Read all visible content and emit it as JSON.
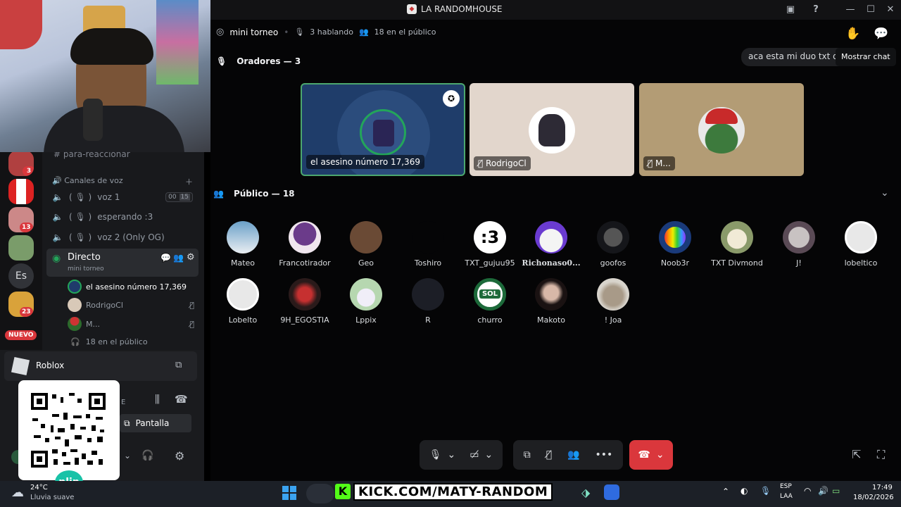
{
  "window": {
    "title": "LA RANDOMHOUSE"
  },
  "stage": {
    "name": "mini torneo",
    "speaking": "3 hablando",
    "audience": "18 en el público",
    "chat_preview": "aca esta mi duo txt di",
    "show_chat_tooltip": "Mostrar chat",
    "speakers_header": "Oradores — 3",
    "public_header": "Público — 18",
    "speakers": [
      {
        "label": "el asesino número 17,369"
      },
      {
        "label": "RodrigoCl"
      },
      {
        "label": "M..."
      }
    ],
    "public": [
      {
        "name": "Mateo"
      },
      {
        "name": "Francotirador"
      },
      {
        "name": "Geo"
      },
      {
        "name": "Toshiro"
      },
      {
        "name": "TXT_gujuu95"
      },
      {
        "name": "Richonaso0..."
      },
      {
        "name": "goofos"
      },
      {
        "name": "Noob3r"
      },
      {
        "name": "TXT Divmond"
      },
      {
        "name": "J!"
      },
      {
        "name": "lobeltico"
      },
      {
        "name": "Lobelto"
      },
      {
        "name": "9H_EGOSTIA"
      },
      {
        "name": "Lppix"
      },
      {
        "name": "R"
      },
      {
        "name": "churro"
      },
      {
        "name": "Makoto"
      },
      {
        "name": "! Joa"
      }
    ],
    "tile_avatar_text": {
      "third_1": ":3",
      "churro": "SOL"
    }
  },
  "sidebar": {
    "channel_partial": "para-reaccionar",
    "voice_header": "Canales de voz",
    "voice_channels": [
      {
        "name": "voz 1",
        "count_a": "00",
        "count_b": "15"
      },
      {
        "name": "esperando :3"
      },
      {
        "name": "voz 2 (Only OG)"
      }
    ],
    "live": {
      "name": "Directo",
      "subtitle": "mini torneo"
    },
    "members": [
      {
        "name": "el asesino número 17,369"
      },
      {
        "name": "RodrigoCl"
      },
      {
        "name": "M..."
      }
    ],
    "audience_line": "18 en el público"
  },
  "rail": {
    "badges": [
      "3",
      "13",
      "23"
    ],
    "es_label": "Es",
    "new_label": "NUEVO"
  },
  "panel": {
    "activity": "Roblox",
    "screen_button": "Pantalla",
    "qr_brand": "plin",
    "partial_letter": "E"
  },
  "overlay": {
    "kick_url": "KICK.COM/MATY-RANDOM",
    "kick_logo": "K"
  },
  "taskbar": {
    "temp": "24°C",
    "weather": "Lluvia suave",
    "lang_1": "ESP",
    "lang_2": "LAA",
    "time": "17:49",
    "date": "18/02/2026"
  },
  "colors": {
    "accent_red": "#da373c",
    "live_green": "#23a55a",
    "selected_border": "#4ca76e",
    "hangup": "#da373c"
  }
}
